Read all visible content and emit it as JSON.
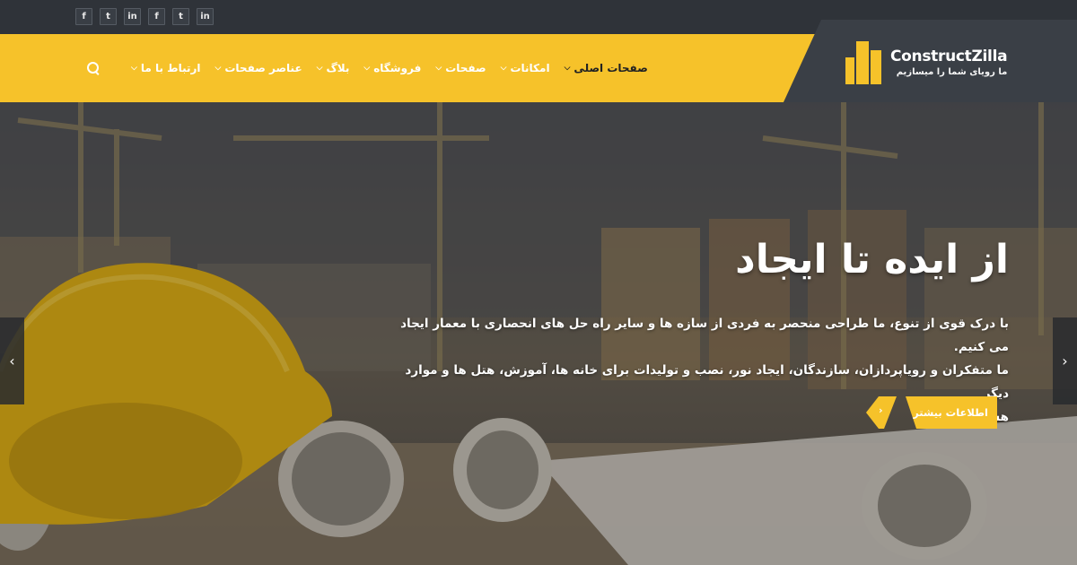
{
  "topbar": {
    "social": [
      {
        "icon": "facebook-icon",
        "glyph": "f"
      },
      {
        "icon": "twitter-icon",
        "glyph": "t"
      },
      {
        "icon": "linkedin-icon",
        "glyph": "in"
      },
      {
        "icon": "facebook-icon",
        "glyph": "f"
      },
      {
        "icon": "twitter-icon",
        "glyph": "t"
      },
      {
        "icon": "linkedin-icon",
        "glyph": "in"
      }
    ]
  },
  "logo": {
    "name": "ConstructZilla",
    "tagline": "ما رویای شما را میسازیم"
  },
  "nav": {
    "items": [
      {
        "label": "صفحات اصلی",
        "active": true
      },
      {
        "label": "امکانات"
      },
      {
        "label": "صفحات"
      },
      {
        "label": "فروشگاه"
      },
      {
        "label": "بلاگ"
      },
      {
        "label": "عناصر صفحات"
      },
      {
        "label": "ارتباط با ما"
      }
    ],
    "search_icon": "search-icon"
  },
  "hero": {
    "title": "از ایده تا ایجاد",
    "description_lines": [
      "با درک قوی از تنوع، ما طراحی منحصر به فردی از سازه ها و سایر راه حل های انحصاری با معمار ایجاد می کنیم.",
      "ما متفکران و رویاپردازان، سازندگان، ایجاد نور، نصب و تولیدات برای خانه ها، آموزش، هتل ها و موارد دیگر",
      "هستیم."
    ],
    "cta_label": "اطلاعات بیشتر",
    "cta_arrow": "›",
    "prev_arrow": "‹",
    "next_arrow": "›"
  },
  "colors": {
    "accent": "#f6c22a",
    "dark": "#2f3339",
    "logo_bg": "#3a3f46"
  }
}
